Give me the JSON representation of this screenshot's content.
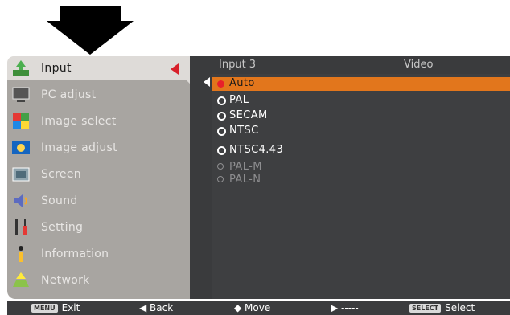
{
  "menu": {
    "items": [
      {
        "label": "Input",
        "icon": "input-icon"
      },
      {
        "label": "PC adjust",
        "icon": "pc-adjust-icon"
      },
      {
        "label": "Image select",
        "icon": "image-select-icon"
      },
      {
        "label": "Image adjust",
        "icon": "image-adjust-icon"
      },
      {
        "label": "Screen",
        "icon": "screen-icon"
      },
      {
        "label": "Sound",
        "icon": "sound-icon"
      },
      {
        "label": "Setting",
        "icon": "setting-icon"
      },
      {
        "label": "Information",
        "icon": "information-icon"
      },
      {
        "label": "Network",
        "icon": "network-icon"
      }
    ],
    "active": "Input"
  },
  "submenu": {
    "header_left": "Input 3",
    "header_right": "Video",
    "options": [
      {
        "label": "Auto",
        "state": "selected"
      },
      {
        "label": "PAL",
        "state": "normal"
      },
      {
        "label": "SECAM",
        "state": "normal"
      },
      {
        "label": "NTSC",
        "state": "normal"
      },
      {
        "label": "NTSC4.43",
        "state": "normal"
      },
      {
        "label": "PAL-M",
        "state": "disabled"
      },
      {
        "label": "PAL-N",
        "state": "disabled"
      }
    ]
  },
  "footer": {
    "exit_key": "MENU",
    "exit_label": "Exit",
    "back_label": "◀ Back",
    "move_label": "◆ Move",
    "next_label": "▶ -----",
    "select_key": "SELECT",
    "select_label": "Select"
  },
  "colors": {
    "highlight": "#e2761c",
    "marker": "#e8202a",
    "panel_dark": "#3a3b3d",
    "panel_gray": "#a8a5a1"
  }
}
